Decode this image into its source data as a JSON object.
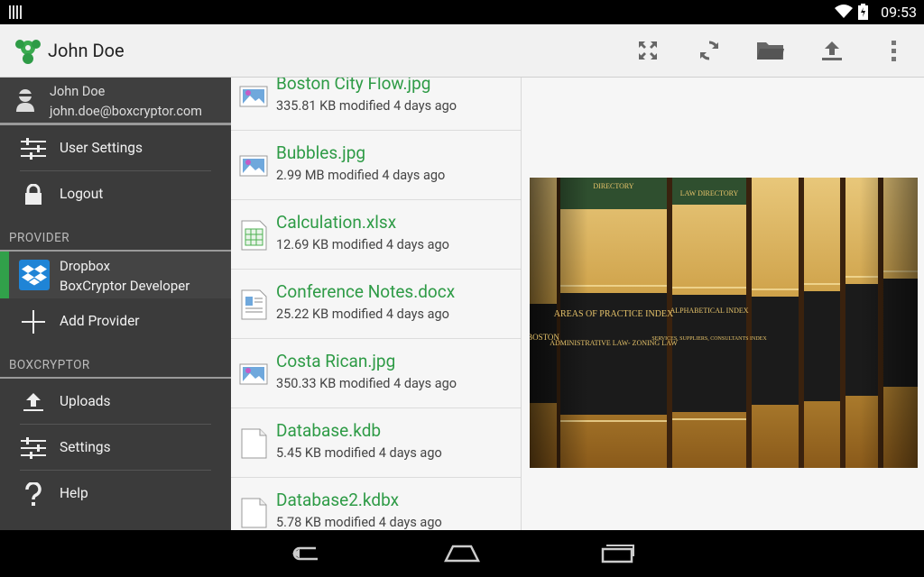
{
  "status_bar": {
    "time": "09:53"
  },
  "app_bar": {
    "title": "John Doe",
    "actions": [
      "fullscreen-icon",
      "refresh-icon",
      "folder-icon",
      "upload-icon",
      "overflow-menu-icon"
    ]
  },
  "drawer": {
    "account": {
      "name": "John Doe",
      "email": "john.doe@boxcryptor.com"
    },
    "top_items": [
      {
        "label": "User Settings",
        "icon": "sliders-icon"
      },
      {
        "label": "Logout",
        "icon": "lock-icon"
      }
    ],
    "provider_section": "PROVIDER",
    "provider": {
      "name": "Dropbox",
      "account": "BoxCryptor Developer"
    },
    "add_provider": "Add Provider",
    "boxcryptor_section": "BOXCRYPTOR",
    "bottom_items": [
      {
        "label": "Uploads",
        "icon": "upload-icon"
      },
      {
        "label": "Settings",
        "icon": "sliders-icon"
      },
      {
        "label": "Help",
        "icon": "question-icon"
      }
    ]
  },
  "files": [
    {
      "name": "Boston City Flow.jpg",
      "meta": "335.81 KB modified 4 days ago",
      "type": "image"
    },
    {
      "name": "Bubbles.jpg",
      "meta": "2.99 MB modified 4 days ago",
      "type": "image"
    },
    {
      "name": "Calculation.xlsx",
      "meta": "12.69 KB modified 4 days ago",
      "type": "spreadsheet"
    },
    {
      "name": "Conference Notes.docx",
      "meta": "25.22 KB modified 4 days ago",
      "type": "document"
    },
    {
      "name": "Costa Rican.jpg",
      "meta": "350.33 KB modified 4 days ago",
      "type": "image"
    },
    {
      "name": "Database.kdb",
      "meta": "5.45 KB modified 4 days ago",
      "type": "file"
    },
    {
      "name": "Database2.kdbx",
      "meta": "5.78 KB modified 4 days ago",
      "type": "file"
    }
  ],
  "preview": {
    "spine_labels": [
      "AREAS OF PRACTICE INDEX",
      "ADMINISTRATIVE LAW- ZONING LAW",
      "ALPHABETICAL INDEX",
      "SERVICES, SUPPLIERS, CONSULTANTS INDEX",
      "LAW DIRECTORY",
      "DIRECTORY",
      "BOSTON"
    ]
  },
  "colors": {
    "accent": "#2e9b46",
    "drawer_bg": "#3b3b3b",
    "appbar_bg": "#f1f1f1",
    "dropbox_blue": "#1f84d6"
  }
}
